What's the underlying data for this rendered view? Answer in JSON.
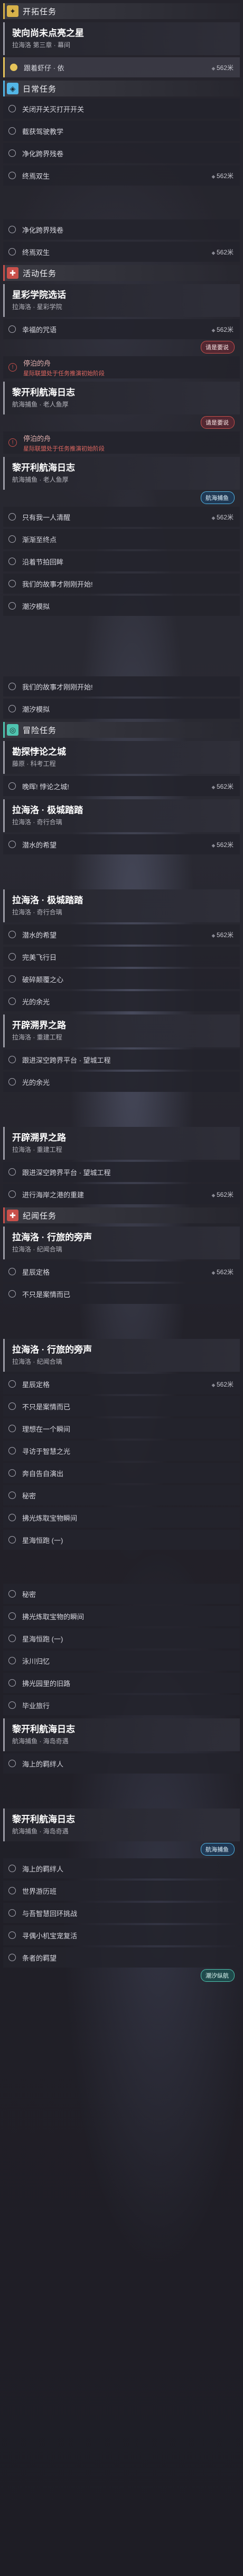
{
  "sections": {
    "lead": {
      "title": "开拓任务"
    },
    "daily": {
      "title": "日常任务"
    },
    "event": {
      "title": "活动任务"
    },
    "trail": {
      "title": "冒险任务"
    },
    "memory": {
      "title": "纪闻任务"
    }
  },
  "lead": {
    "group1": {
      "title": "驶向尚未点亮之星",
      "sub": "拉海洛 第三章 · 幕间"
    },
    "row1": {
      "label": "跟着虾仔 · 依",
      "dist": "562米"
    }
  },
  "daily": {
    "rows": [
      "关闭开关灭打开开关",
      "截获驾驶教学",
      "净化跨界残卷",
      "终焉双生"
    ],
    "row4_dist": "562米",
    "cont_rows": [
      "净化跨界残卷",
      "终焉双生"
    ],
    "cont_dist": "562米"
  },
  "event": {
    "g1": {
      "title": "星彩学院选话",
      "sub": "拉海洛 · 星彩学院"
    },
    "g1_rows": [
      "幸福的咒语"
    ],
    "g1_dist": "562米",
    "g1_badge": "请是要说",
    "warn1": {
      "title": "停泊的舟",
      "note": "星际联盟处于任务推演初始阶段"
    },
    "g2": {
      "title": "黎开利航海日志",
      "sub": "航海捕鱼 · 老人鱼厚"
    },
    "g2_badge": "请是要说",
    "warn2": {
      "title": "停泊的舟",
      "note": "星际联盟处于任务推演初始阶段"
    },
    "g3": {
      "title": "黎开利航海日志",
      "sub": "航海捕鱼 · 老人鱼厚"
    },
    "g3_badge": "航海捕鱼",
    "g3_rows": [
      "只有我一人清醒",
      "渐渐至终点",
      "沿着节拍回眸",
      "我们的故事才刚刚开始!",
      "潮汐模拟"
    ],
    "g3_dist": "562米",
    "cont_rows": [
      "我们的故事才刚刚开始!",
      "潮汐模拟"
    ]
  },
  "trail": {
    "g1": {
      "title": "勘探悖论之城",
      "sub": "藤原 · 科考工程"
    },
    "g1_rows": [
      "晚晖! 悖论之城!"
    ],
    "g1_dist": "562米",
    "g2": {
      "title": "拉海洛 · 极城踏踏",
      "sub": "拉海洛 · 奇行合璃"
    },
    "g2_rows": [
      "潜水的希望"
    ],
    "g2_dist": "562米",
    "g3": {
      "title": "拉海洛 · 极城踏踏",
      "sub": "拉海洛 · 奇行合璃"
    },
    "g3_rows": [
      "潜水的希望",
      "完美飞行日",
      "破碎颠覆之心",
      "光的余光"
    ],
    "g3_dist": "562米",
    "g4": {
      "title": "开辟溯界之路",
      "sub": "拉海洛 · 重建工程"
    },
    "g4_rows": [
      "跟进深空跨界平台 · 望城工程",
      "光的余光"
    ],
    "g5": {
      "title": "开辟溯界之路",
      "sub": "拉海洛 · 重建工程"
    },
    "g5_rows": [
      "跟进深空跨界平台 · 望城工程",
      "进行海岸之港的重建"
    ],
    "g5_dist": "562米"
  },
  "memory": {
    "g1": {
      "title": "拉海洛 · 行旅的旁声",
      "sub": "拉海洛 · 纪闻合璃"
    },
    "g1_rows": [
      "星辰定格",
      "不只是案情而已"
    ],
    "g1_dist": "562米",
    "g2": {
      "title": "拉海洛 · 行旅的旁声",
      "sub": "拉海洛 · 纪闻合璃"
    },
    "g2_rows": [
      "星辰定格",
      "不只是案情而已",
      "理想在一个瞬间",
      "寻访于智慧之光",
      "奔自告自演出",
      "秘密",
      "拂光炼取宝物瞬间",
      "星海恒跑 (一)"
    ],
    "g2_dist": "562米",
    "g3_rows": [
      "秘密",
      "拂光炼取宝物的瞬间",
      "星海恒跑 (一)",
      "泳川归忆",
      "拂光园里的旧路",
      "毕业旅行"
    ],
    "g4": {
      "title": "黎开利航海日志",
      "sub": "航海捕鱼 · 海岛奇遇"
    },
    "g4_rows": [
      "海上的羁绊人"
    ],
    "g5": {
      "title": "黎开利航海日志",
      "sub": "航海捕鱼 · 海岛奇遇"
    },
    "g5_badge": "航海捕鱼",
    "g5_rows": [
      "海上的羁绊人",
      "世界游历班",
      "与吾智慧回环挑战",
      "寻偶小机宝宠复活",
      "条者的羁望"
    ],
    "footer_badge": "潮汐纵航"
  }
}
